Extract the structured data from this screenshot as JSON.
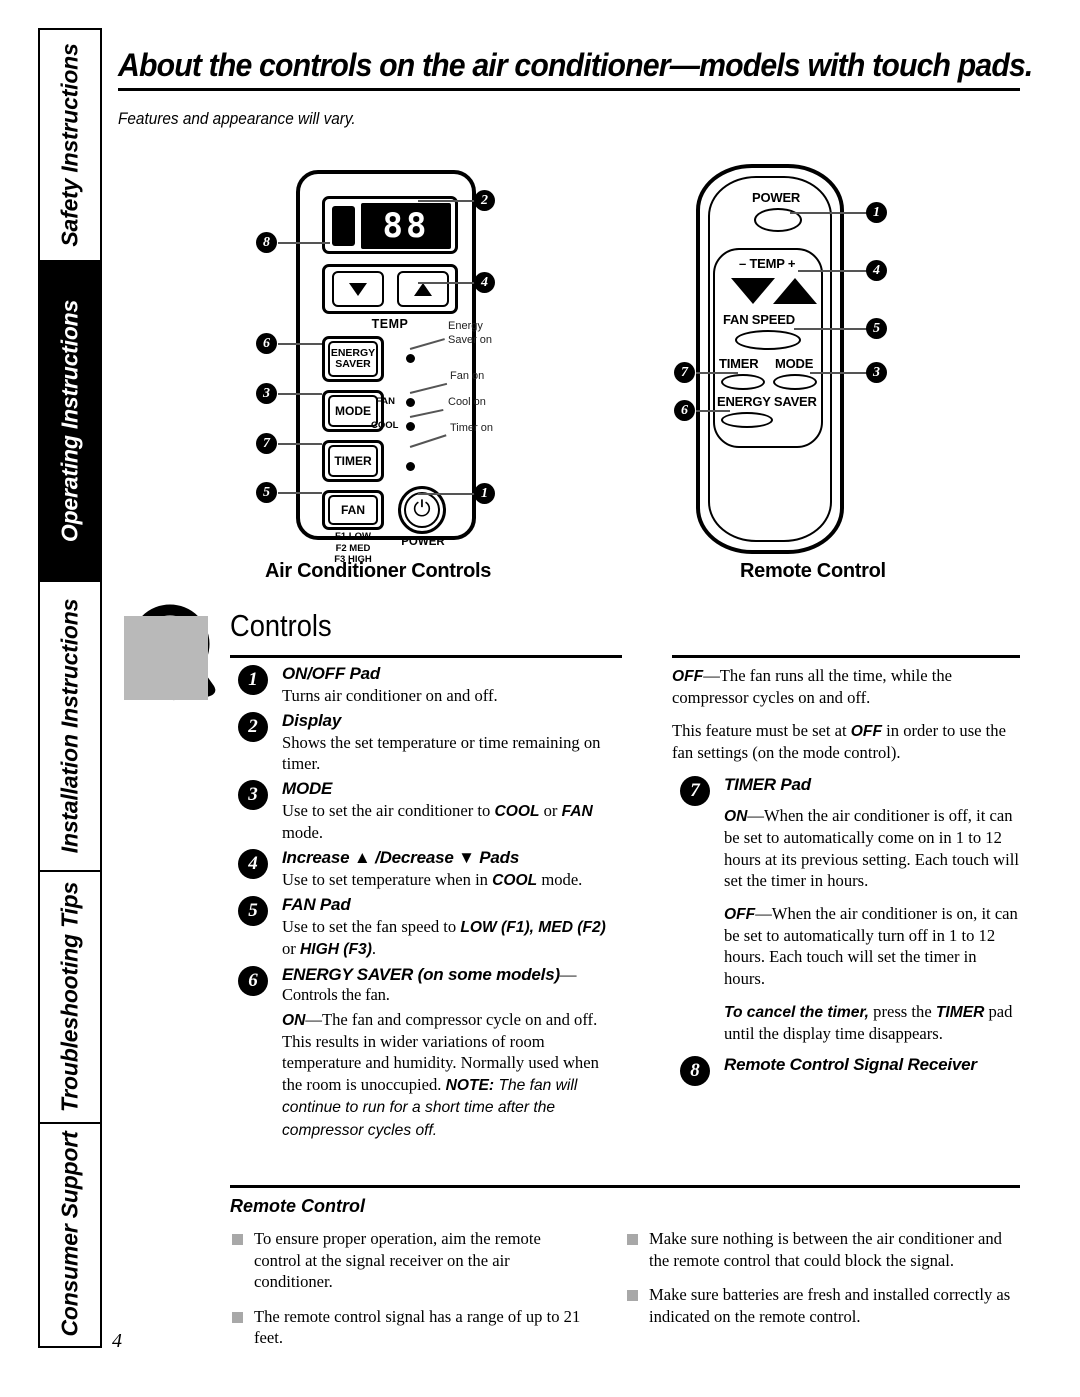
{
  "sidebar": {
    "sections": [
      {
        "label": "Safety Instructions",
        "active": false
      },
      {
        "label": "Operating Instructions",
        "active": true
      },
      {
        "label": "Installation Instructions",
        "active": false
      },
      {
        "label": "Troubleshooting Tips",
        "active": false
      },
      {
        "label": "Consumer Support",
        "active": false
      }
    ]
  },
  "header": {
    "title": "About the controls on the air conditioner—models with touch pads.",
    "subtitle": "Features and appearance will vary."
  },
  "diagrams": {
    "ac_caption": "Air Conditioner Controls",
    "remote_caption": "Remote Control",
    "ac_panel": {
      "display_value": "88",
      "temp_label": "TEMP",
      "keys": {
        "energy_saver_line1": "ENERGY",
        "energy_saver_line2": "SAVER",
        "mode": "MODE",
        "timer": "TIMER",
        "fan": "FAN"
      },
      "fan_speeds": [
        "F1 LOW",
        "F2 MED",
        "F3 HIGH"
      ],
      "power_label": "POWER",
      "power_icon": "power-symbol",
      "led_labels": {
        "fan": "FAN",
        "cool": "COOL"
      },
      "annotations": {
        "energy_saver_on_l1": "Energy",
        "energy_saver_on_l2": "Saver on",
        "fan_on": "Fan on",
        "cool_on": "Cool on",
        "timer_on": "Timer on"
      },
      "callouts": [
        "8",
        "2",
        "4",
        "6",
        "3",
        "7",
        "5",
        "1"
      ]
    },
    "remote": {
      "power": "POWER",
      "temp": "– TEMP +",
      "fan_speed": "FAN SPEED",
      "timer": "TIMER",
      "mode": "MODE",
      "energy_saver": "ENERGY SAVER",
      "callouts": [
        "1",
        "4",
        "5",
        "7",
        "3",
        "6"
      ]
    }
  },
  "controls": {
    "heading": "Controls",
    "items": [
      {
        "num": "1",
        "title": "ON/OFF Pad",
        "body": "Turns air conditioner on and off."
      },
      {
        "num": "2",
        "title": "Display",
        "body": "Shows the set temperature or time remaining on timer."
      },
      {
        "num": "3",
        "title": "MODE",
        "body_pre": "Use to set the air conditioner to ",
        "body_b1": "COOL",
        "body_mid": " or ",
        "body_b2": "FAN",
        "body_post": " mode."
      },
      {
        "num": "4",
        "title": "Increase ▲ /Decrease ▼ Pads",
        "body_pre": "Use to set temperature when in ",
        "body_b1": "COOL",
        "body_post": " mode."
      },
      {
        "num": "5",
        "title": "FAN Pad",
        "body_pre": "Use to set the fan speed to ",
        "body_b1": "LOW (F1), MED (F2)",
        "body_mid": " or ",
        "body_b2": "HIGH (F3)",
        "body_post": "."
      },
      {
        "num": "6",
        "title_b": "ENERGY SAVER",
        "title_i": " (on some models)",
        "title_post": "—Controls the fan."
      }
    ],
    "energy_on": {
      "label": "ON",
      "text": "—The fan and compressor cycle on and off. This results in wider variations of room temperature and humidity. Normally used when the room is unoccupied. ",
      "note_label": "NOTE:",
      "note_text": " The fan will continue to run for a short time after the compressor cycles off."
    },
    "energy_off": {
      "label": "OFF",
      "text": "—The fan runs all the time, while the compressor cycles on and off."
    },
    "feature_note": {
      "pre": "This feature must be set at ",
      "bold": "OFF",
      "post": " in order to use the fan settings (on the mode control)."
    },
    "timer": {
      "num": "7",
      "title": "TIMER Pad",
      "on_label": "ON",
      "on_text": "—When the air conditioner is off, it can be set to automatically come on in 1 to 12 hours at its previous setting. Each touch will set the timer in hours.",
      "off_label": "OFF",
      "off_text": "—When the air conditioner is on, it can be set to automatically turn off in 1 to 12 hours. Each touch will set the timer in hours.",
      "cancel_bold": "To cancel the timer,",
      "cancel_pre": " press the ",
      "cancel_b2": "TIMER",
      "cancel_post": " pad until the display time disappears."
    },
    "receiver": {
      "num": "8",
      "title": "Remote Control Signal Receiver"
    }
  },
  "remote_tips": {
    "heading": "Remote Control",
    "left_bullets": [
      "To ensure proper operation, aim the remote control at the signal receiver on the air conditioner.",
      "The remote control signal has a range of up to 21 feet."
    ],
    "right_bullets": [
      "Make sure nothing is between the air conditioner and the remote control that could block the signal.",
      "Make sure batteries are fresh and installed correctly as indicated on the remote control."
    ]
  },
  "page_number": "4"
}
